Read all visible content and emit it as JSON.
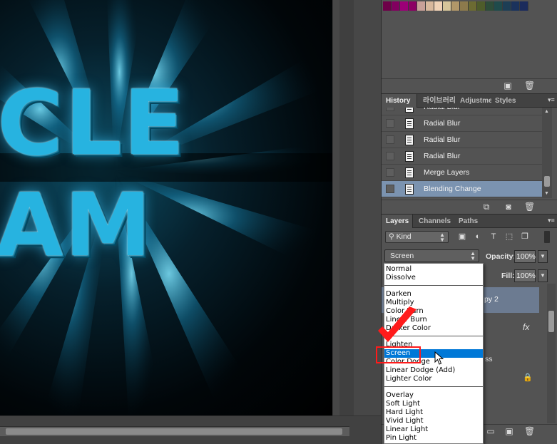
{
  "canvas": {
    "art_line_1": "CLE",
    "art_line_2": "AM"
  },
  "swatches": {
    "colors": [
      "#6d0048",
      "#82005f",
      "#9c0077",
      "#8c0064",
      "#c8a098",
      "#d8b89c",
      "#f0d2b6",
      "#d6c59a",
      "#b19769",
      "#8d7a4c",
      "#6c6b32",
      "#4e5c2a",
      "#2d4d39",
      "#1f4b4b",
      "#1d3e55",
      "#1a325c",
      "#1b2b5c"
    ]
  },
  "history": {
    "tabs": [
      "History",
      "라이브러리",
      "Adjustme",
      "Styles"
    ],
    "items": [
      {
        "label": "Radial Blur",
        "selected": false
      },
      {
        "label": "Radial Blur",
        "selected": false
      },
      {
        "label": "Radial Blur",
        "selected": false
      },
      {
        "label": "Radial Blur",
        "selected": false
      },
      {
        "label": "Merge Layers",
        "selected": false
      },
      {
        "label": "Blending Change",
        "selected": true
      }
    ]
  },
  "layers": {
    "tabs": [
      "Layers",
      "Channels",
      "Paths"
    ],
    "kind_label": "Kind",
    "blend_mode": "Screen",
    "opacity_label": "Opacity:",
    "opacity_value": "100%",
    "fill_label": "Fill:",
    "fill_value": "100%",
    "selected_layer_name_partial": "py 2",
    "fx_label": "fx",
    "partial_text": "ss"
  },
  "blend_menu": {
    "groups": [
      [
        "Normal",
        "Dissolve"
      ],
      [
        "Darken",
        "Multiply",
        "Color Burn",
        "Linear Burn",
        "Darker Color"
      ],
      [
        "Lighten",
        "Screen",
        "Color Dodge",
        "Linear Dodge (Add)",
        "Lighter Color"
      ],
      [
        "Overlay",
        "Soft Light",
        "Hard Light",
        "Vivid Light",
        "Linear Light",
        "Pin Light"
      ]
    ],
    "highlighted": "Screen"
  },
  "annotation": {
    "color": "#ff1b1b"
  },
  "colors": {
    "panel_bg": "#535353",
    "selection_blue": "#0078d7",
    "history_selected": "#7b93b0",
    "layer_selected": "#6c7b91"
  }
}
